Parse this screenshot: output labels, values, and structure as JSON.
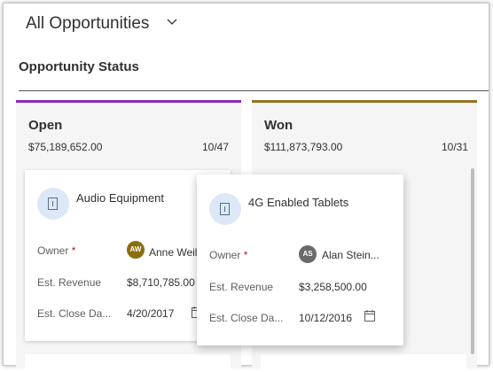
{
  "header": {
    "view_title": "All Opportunities"
  },
  "section": {
    "title": "Opportunity Status"
  },
  "columns": [
    {
      "name": "Open",
      "total": "$75,189,652.00",
      "count": "10/47",
      "color": "#8b2bb5"
    },
    {
      "name": "Won",
      "total": "$111,873,793.00",
      "count": "10/31",
      "color": "#98721c"
    }
  ],
  "cards": [
    {
      "title": "Audio Equipment",
      "owner_label": "Owner",
      "owner_initials": "AW",
      "owner_name": "Anne Weiler",
      "owner_color": "#8a6d0f",
      "revenue_label": "Est. Revenue",
      "revenue": "$8,710,785.00",
      "close_label": "Est. Close Da...",
      "close_date": "4/20/2017"
    },
    {
      "title": "4G Enabled Tablets",
      "owner_label": "Owner",
      "owner_initials": "AS",
      "owner_name": "Alan Stein...",
      "owner_color": "#6a6a6a",
      "revenue_label": "Est. Revenue",
      "revenue": "$3,258,500.00",
      "close_label": "Est. Close Da...",
      "close_date": "10/12/2016"
    }
  ],
  "icons": {
    "view_selector": "chevron-down-icon",
    "record": "opportunity-record-icon",
    "calendar": "calendar-icon"
  },
  "required_marker": "*"
}
